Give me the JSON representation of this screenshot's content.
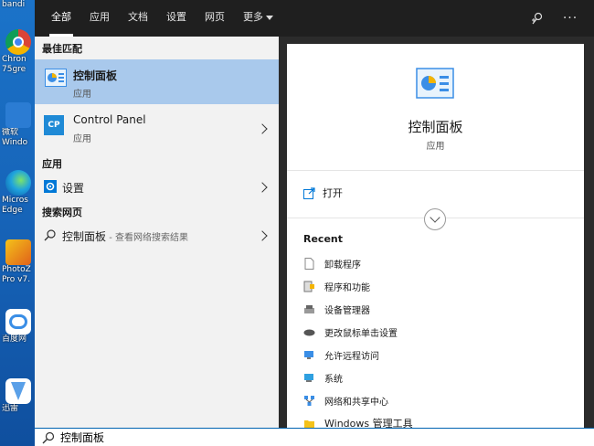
{
  "desktop": {
    "items": [
      {
        "label": "Chron",
        "label2": "75gre",
        "icon": "chrome-icon",
        "color": "#db4437"
      },
      {
        "label": "微软",
        "label2": "Windo",
        "icon": "shortcut-icon",
        "color": "#2b7cd3"
      },
      {
        "label": "Micros",
        "label2": "Edge",
        "icon": "edge-icon",
        "color": "#1fa3de"
      },
      {
        "label": "PhotoZ",
        "label2": "Pro v7.",
        "icon": "photozoom-icon",
        "color": "#e08b1a"
      },
      {
        "label": "百度网",
        "label2": "",
        "icon": "baidu-netdisk-icon",
        "color": "#3a8ee6"
      },
      {
        "label": "迅雷",
        "label2": "",
        "icon": "thunder-icon",
        "color": "#5aa0e8"
      }
    ],
    "top_partial": "bandi"
  },
  "topbar": {
    "tabs": [
      {
        "label": "全部",
        "active": true
      },
      {
        "label": "应用",
        "active": false
      },
      {
        "label": "文档",
        "active": false
      },
      {
        "label": "设置",
        "active": false
      },
      {
        "label": "网页",
        "active": false
      },
      {
        "label": "更多",
        "active": false
      }
    ],
    "feedback_icon": "feedback-icon",
    "more_glyph": "···"
  },
  "left": {
    "best_match_header": "最佳匹配",
    "best_match": {
      "title": "控制面板",
      "subtitle": "应用"
    },
    "control_panel": {
      "title": "Control Panel",
      "subtitle": "应用",
      "badge": "CP"
    },
    "apps_header": "应用",
    "settings": {
      "title": "设置"
    },
    "web_header": "搜索网页",
    "web_result": {
      "title": "控制面板",
      "suffix": " - 查看网络搜索结果"
    }
  },
  "right": {
    "app_title": "控制面板",
    "app_type": "应用",
    "open_label": "打开",
    "recent_header": "Recent",
    "recent_items": [
      "卸载程序",
      "程序和功能",
      "设备管理器",
      "更改鼠标单击设置",
      "允许远程访问",
      "系统",
      "网络和共享中心",
      "Windows 管理工具"
    ]
  },
  "search": {
    "value": "控制面板"
  },
  "colors": {
    "accent": "#0078d7",
    "selection": "#a9c9ec",
    "panel": "#2b2b2b"
  }
}
